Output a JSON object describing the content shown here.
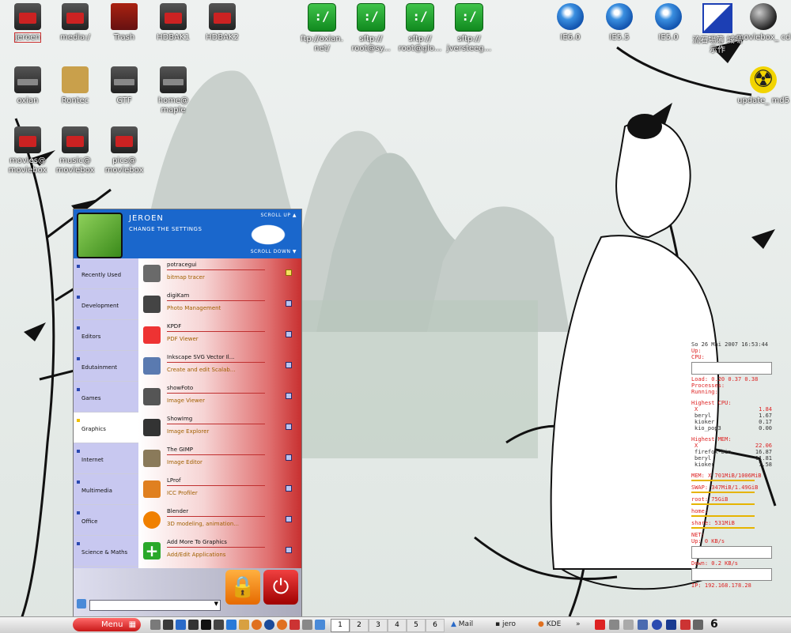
{
  "desktop": {
    "icons_row1": [
      {
        "label": "jeroen",
        "kind": "user"
      },
      {
        "label": "media:/",
        "kind": "drive-red"
      },
      {
        "label": "Trash",
        "kind": "trash"
      },
      {
        "label": "HDBAK1",
        "kind": "drive-red"
      },
      {
        "label": "HDBAK2",
        "kind": "drive-red"
      }
    ],
    "icons_row2": [
      {
        "label": "oxian",
        "kind": "drive-grey"
      },
      {
        "label": "Rontec",
        "kind": "lock"
      },
      {
        "label": "GTF",
        "kind": "drive-grey"
      },
      {
        "label": "home@ maple",
        "kind": "drive-grey"
      }
    ],
    "icons_row3": [
      {
        "label": "movies@ moviebox",
        "kind": "drive-red"
      },
      {
        "label": "music@ moviebox",
        "kind": "drive-red"
      },
      {
        "label": "pics@ moviebox",
        "kind": "drive-red"
      }
    ],
    "sftp_icons": [
      {
        "label": "ftp://oxian. net/",
        "glyph": ":/"
      },
      {
        "label": "sftp:// root@sy...",
        "glyph": ":/"
      },
      {
        "label": "sftp:// root@glo...",
        "glyph": ":/"
      },
      {
        "label": "sftp:// jversteeg...",
        "glyph": ":/"
      }
    ],
    "ie_icons": [
      {
        "label": "IE6.0"
      },
      {
        "label": "IE5.5"
      },
      {
        "label": "IE5.0"
      }
    ],
    "right_icons": [
      {
        "label": "流石場簿 城場示作",
        "kind": "shield"
      },
      {
        "label": "moviebox_ cd",
        "kind": "ball"
      },
      {
        "label": "update_ md5",
        "kind": "nuke"
      }
    ]
  },
  "menu": {
    "user": "JEROEN",
    "subtitle": "CHANGE THE SETTINGS",
    "scroll_up": "SCROLL UP",
    "scroll_down": "SCROLL DOWN",
    "categories": [
      "Recently Used",
      "Development",
      "Editors",
      "Edutainment",
      "Games",
      "Graphics",
      "Internet",
      "Multimedia",
      "Office",
      "Science & Maths"
    ],
    "active_category": "Graphics",
    "apps": [
      {
        "name": "potracegui",
        "desc": "bitmap tracer",
        "color": "#6a6a6a"
      },
      {
        "name": "digiKam",
        "desc": "Photo Management",
        "color": "#444"
      },
      {
        "name": "KPDF",
        "desc": "PDF Viewer",
        "color": "#e33"
      },
      {
        "name": "Inkscape SVG Vector Il...",
        "desc": "Create and edit Scalab...",
        "color": "#5a7ab0"
      },
      {
        "name": "showFoto",
        "desc": "Image Viewer",
        "color": "#555"
      },
      {
        "name": "ShowImg",
        "desc": "Image Explorer",
        "color": "#333"
      },
      {
        "name": "The GIMP",
        "desc": "Image Editor",
        "color": "#8a7a5a"
      },
      {
        "name": "LProf",
        "desc": "ICC Profiler",
        "color": "#e08020"
      },
      {
        "name": "Blender",
        "desc": "3D modeling, animation...",
        "color": "#f08000"
      },
      {
        "name": "Add More To Graphics",
        "desc": "Add/Edit Applications",
        "color": "#2aa82a"
      }
    ]
  },
  "sysmon": {
    "header": "So 26 Mai 2007 16:53:44",
    "up": "Up: ",
    "cpu": "CPU: ",
    "load": "Load: 0.20 0.37 0.38",
    "processes": "Processes: ",
    "running": "Running: ",
    "highest_cpu_title": "Highest CPU:",
    "highest_cpu": [
      {
        "name": "X",
        "val": "1.84"
      },
      {
        "name": "beryl",
        "val": "1.67"
      },
      {
        "name": "kioker",
        "val": "0.17"
      },
      {
        "name": "kio_pop3",
        "val": "0.00"
      }
    ],
    "highest_mem_title": "Highest MEM:",
    "highest_mem": [
      {
        "name": "X",
        "val": "22.06"
      },
      {
        "name": "firefox-bin",
        "val": "16.87"
      },
      {
        "name": "beryl",
        "val": "11.81"
      },
      {
        "name": "kioker",
        "val": "7.58"
      }
    ],
    "mem": "MEM: X 701MiB/1006MiB",
    "swap": "SWAP: 347MiB/1.49GiB",
    "root": "root: 75GiB",
    "home": "home: ",
    "share": "share: 531MiB",
    "net": "NET:",
    "up_rate": "Up: 0 KB/s",
    "down_rate": "Down: 0.2 KB/s",
    "ip": "IP: 192.168.178.28"
  },
  "taskbar": {
    "menu_label": "Menu",
    "desktops": [
      "1",
      "2",
      "3",
      "4",
      "5",
      "6"
    ],
    "active_desktop": "1",
    "tasks": [
      "Mail",
      "jero",
      "KDE"
    ],
    "clock": "6"
  }
}
